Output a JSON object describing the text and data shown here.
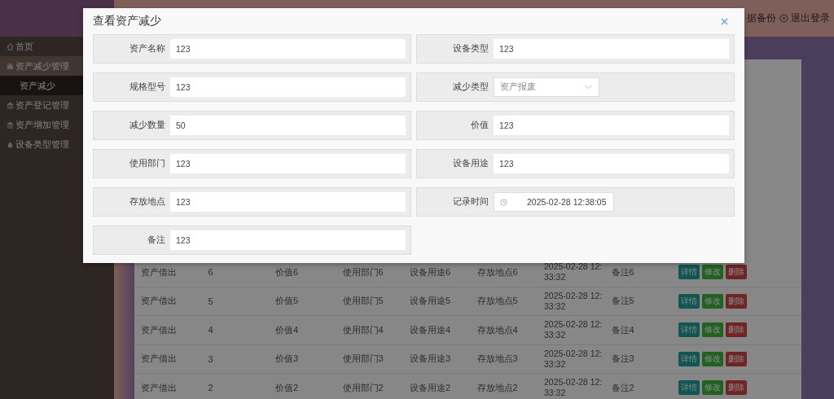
{
  "sidebar": {
    "items": [
      {
        "label": "首页"
      },
      {
        "label": "资产减少管理",
        "expanded": true,
        "children": [
          {
            "label": "资产减少",
            "selected": true
          }
        ]
      },
      {
        "label": "资产登记管理"
      },
      {
        "label": "资产增加管理"
      },
      {
        "label": "设备类型管理"
      }
    ]
  },
  "header": {
    "links": [
      {
        "label": "据备份"
      },
      {
        "label": "退出登录"
      }
    ]
  },
  "table": {
    "rows": [
      {
        "type": "资产借出",
        "count": "6",
        "value": "价值6",
        "dept": "使用部门6",
        "use": "设备用途6",
        "location": "存放地点6",
        "time": "2025-02-28 12:33:32",
        "note": "备注6",
        "actions": [
          {
            "label": "详情",
            "kind": "detail"
          },
          {
            "label": "修改",
            "kind": "edit"
          },
          {
            "label": "删除",
            "kind": "delete"
          }
        ]
      },
      {
        "type": "资产借出",
        "count": "5",
        "value": "价值5",
        "dept": "使用部门5",
        "use": "设备用途5",
        "location": "存放地点5",
        "time": "2025-02-28 12:33:32",
        "note": "备注5",
        "actions": [
          {
            "label": "详情",
            "kind": "detail"
          },
          {
            "label": "修改",
            "kind": "edit"
          },
          {
            "label": "删除",
            "kind": "delete"
          }
        ]
      },
      {
        "type": "资产借出",
        "count": "4",
        "value": "价值4",
        "dept": "使用部门4",
        "use": "设备用途4",
        "location": "存放地点4",
        "time": "2025-02-28 12:33:32",
        "note": "备注4",
        "actions": [
          {
            "label": "详情",
            "kind": "detail"
          },
          {
            "label": "修改",
            "kind": "edit"
          },
          {
            "label": "删除",
            "kind": "delete"
          }
        ]
      },
      {
        "type": "资产借出",
        "count": "3",
        "value": "价值3",
        "dept": "使用部门3",
        "use": "设备用途3",
        "location": "存放地点3",
        "time": "2025-02-28 12:33:32",
        "note": "备注3",
        "actions": [
          {
            "label": "详情",
            "kind": "detail"
          },
          {
            "label": "修改",
            "kind": "edit"
          },
          {
            "label": "删除",
            "kind": "delete"
          }
        ]
      },
      {
        "type": "资产借出",
        "count": "2",
        "value": "价值2",
        "dept": "使用部门2",
        "use": "设备用途2",
        "location": "存放地点2",
        "time": "2025-02-28 12:33:32",
        "note": "备注2",
        "actions": [
          {
            "label": "详情",
            "kind": "detail"
          },
          {
            "label": "修改",
            "kind": "edit"
          },
          {
            "label": "删除",
            "kind": "delete"
          }
        ]
      }
    ]
  },
  "modal": {
    "title": "查看资产减少",
    "fields": [
      {
        "label": "资产名称",
        "value": "123",
        "kind": "text"
      },
      {
        "label": "设备类型",
        "value": "123",
        "kind": "text"
      },
      {
        "label": "规格型号",
        "value": "123",
        "kind": "text"
      },
      {
        "label": "减少类型",
        "value": "资产报废",
        "kind": "select"
      },
      {
        "label": "减少数量",
        "value": "50",
        "kind": "text"
      },
      {
        "label": "价值",
        "value": "123",
        "kind": "text"
      },
      {
        "label": "使用部门",
        "value": "123",
        "kind": "text"
      },
      {
        "label": "设备用途",
        "value": "123",
        "kind": "text"
      },
      {
        "label": "存放地点",
        "value": "123",
        "kind": "text"
      },
      {
        "label": "记录时间",
        "value": "2025-02-28 12:38:05",
        "kind": "datetime"
      },
      {
        "label": "备注",
        "value": "123",
        "kind": "text"
      }
    ]
  }
}
